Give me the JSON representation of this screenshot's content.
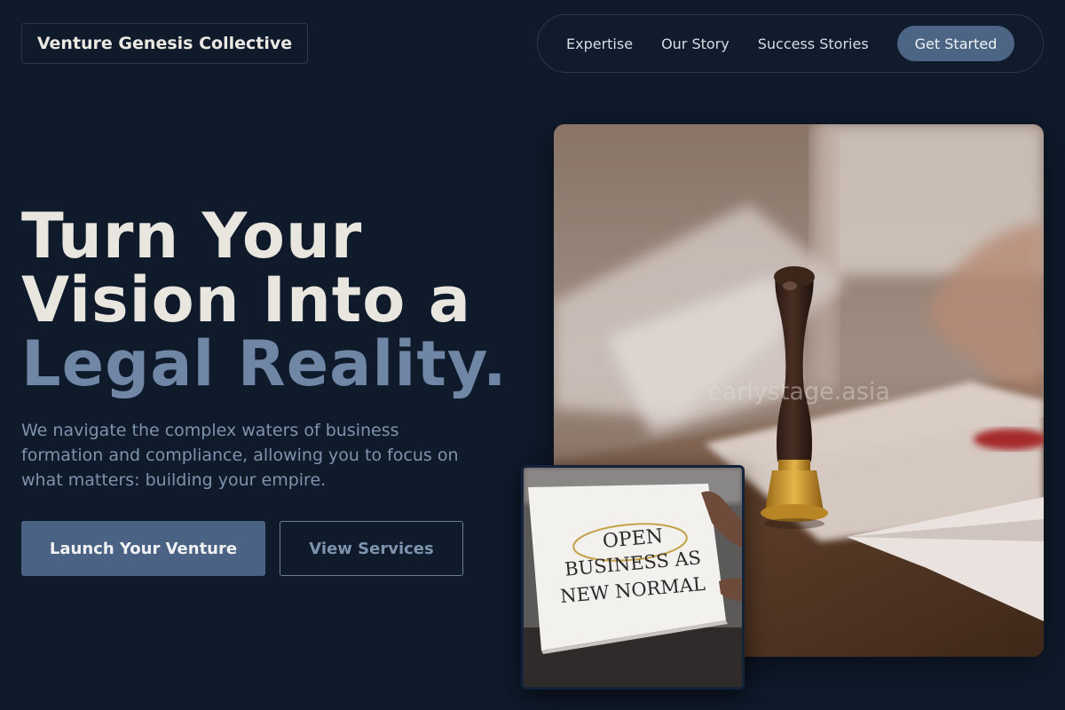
{
  "brand": {
    "name": "Venture Genesis Collective"
  },
  "nav": {
    "links": [
      "Expertise",
      "Our Story",
      "Success Stories"
    ],
    "cta": "Get Started"
  },
  "hero": {
    "headline_line1": "Turn Your",
    "headline_line2": "Vision Into a",
    "headline_line3": "Legal Reality.",
    "subcopy": "We navigate the complex waters of business formation and compliance, allowing you to focus on what matters: building your empire.",
    "primary_cta": "Launch Your Venture",
    "secondary_cta": "View Services"
  },
  "media": {
    "main_image_watermark": "earlystage.asia",
    "sign_text_line1": "OPEN",
    "sign_text_line2": "BUSINESS AS",
    "sign_text_line3": "NEW NORMAL"
  },
  "colors": {
    "background": "#0f1a2b",
    "accent": "#4d6584",
    "headline_highlight": "#6f86a5"
  }
}
